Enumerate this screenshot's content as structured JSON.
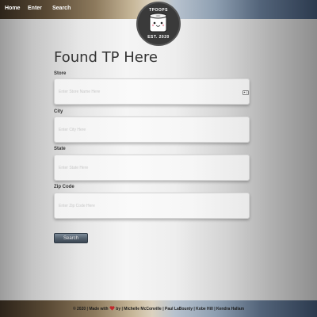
{
  "nav": {
    "links": [
      "Home",
      "Enter",
      "Search"
    ]
  },
  "logo": {
    "top_text": "TPOOPS",
    "bottom_text": "EST. 2020"
  },
  "page_title": "Found TP Here",
  "form": {
    "fields": [
      {
        "label": "Store",
        "placeholder": "Enter Store Name Here"
      },
      {
        "label": "City",
        "placeholder": "Enter City Here"
      },
      {
        "label": "State",
        "placeholder": "Enter State Here"
      },
      {
        "label": "Zip Code",
        "placeholder": "Enter Zip Code Here"
      }
    ],
    "search_button": "Search"
  },
  "footer": {
    "prefix": "© 2020 | Made with",
    "suffix": "by | Michelle McConville | Paul LaBounty | Kobe Hill | Kendra Hallam"
  },
  "colors": {
    "heart": "#c0282d",
    "nav_text": "#ffffff"
  },
  "icons": {
    "store_field_icon": "contact-card-icon",
    "heart": "heart-icon"
  }
}
